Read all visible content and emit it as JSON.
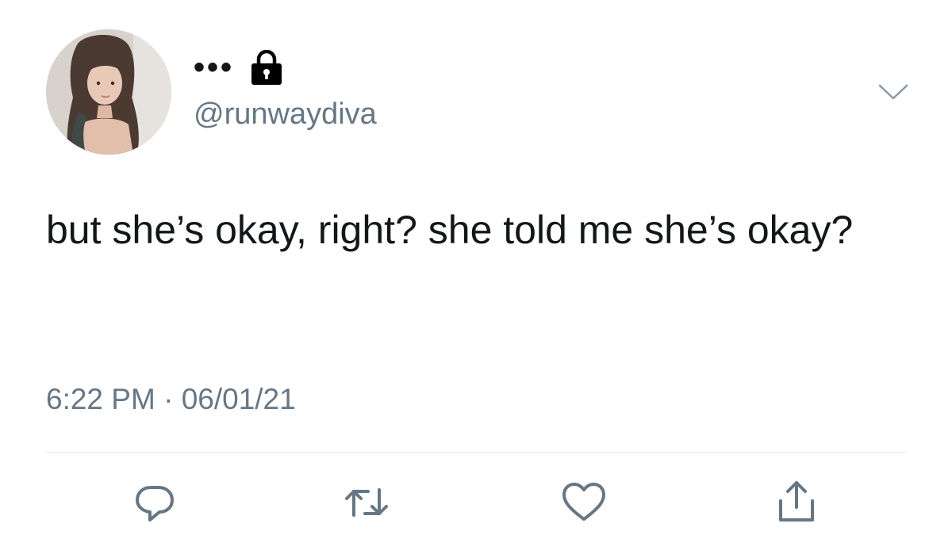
{
  "tweet": {
    "display_name": "•••",
    "handle": "@runwaydiva",
    "text": "but she’s okay, right? she told me she’s okay?",
    "time": "6:22 PM",
    "separator": "·",
    "date": "06/01/21",
    "protected_icon": "lock-icon",
    "more_icon": "chevron-down-icon"
  },
  "actions": [
    {
      "name": "reply",
      "icon": "reply-icon"
    },
    {
      "name": "retweet",
      "icon": "retweet-icon"
    },
    {
      "name": "like",
      "icon": "heart-icon"
    },
    {
      "name": "share",
      "icon": "share-icon"
    }
  ],
  "colors": {
    "text": "#14171a",
    "secondary": "#657786",
    "divider": "#e1e8ed",
    "background": "#ffffff"
  }
}
